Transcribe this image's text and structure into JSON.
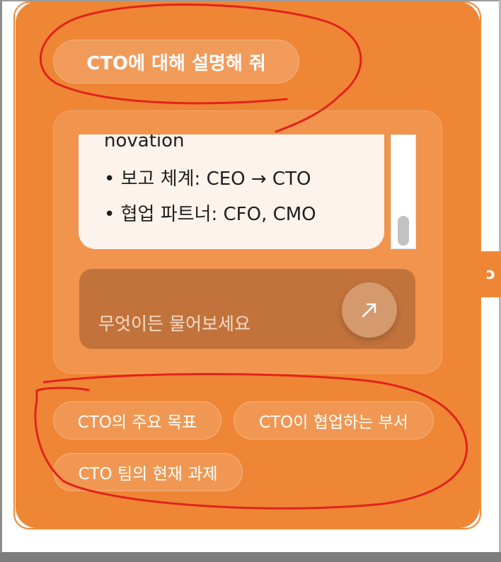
{
  "prompt_pill": {
    "label": "CTO에 대해 설명해 줘"
  },
  "answer": {
    "lines": [
      "novation",
      "• 보고 체계: CEO → CTO",
      "• 협업 파트너: CFO, CMO"
    ]
  },
  "input": {
    "placeholder": "무엇이든 물어보세요"
  },
  "send_button": {
    "icon": "arrow-up-right-icon"
  },
  "suggestions": [
    {
      "label": "CTO의 주요 목표"
    },
    {
      "label": "CTO이 협업하는 부서"
    },
    {
      "label": "CTO 팀의 현재 과제"
    }
  ],
  "edge_tab": {
    "label": "ɔ"
  },
  "colors": {
    "panel": "#ee8636",
    "answer_bg": "#fcf3ec",
    "input_bg": "#c2733c",
    "annotation": "#e2231a"
  }
}
